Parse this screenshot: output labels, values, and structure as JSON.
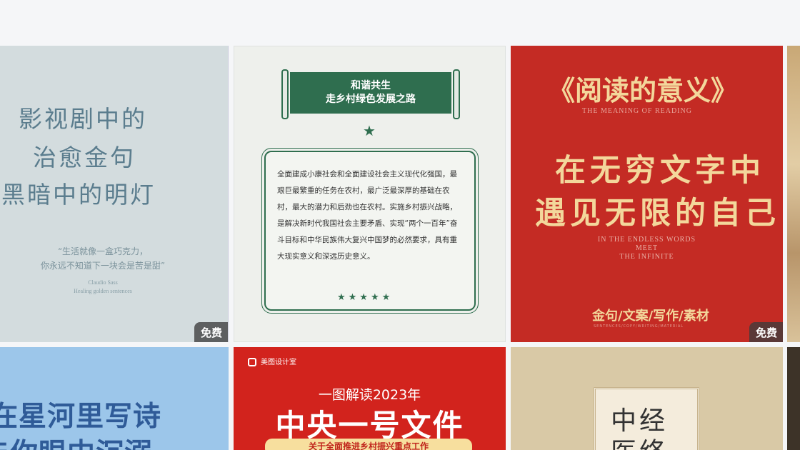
{
  "cards": [
    {
      "title_lines": [
        "影视剧中的",
        "治愈金句",
        "黑暗中的明灯"
      ],
      "quote_lines": [
        "“生活就像一盒巧克力，",
        "你永远不知道下一块会是苦是甜”"
      ],
      "sub_lines": [
        "Claudio Sass",
        "Healing golden sentences"
      ],
      "badge": "免费"
    },
    {
      "banner_lines": [
        "和谐共生",
        "走乡村绿色发展之路"
      ],
      "paragraph": "全面建成小康社会和全面建设社会主义现代化强国，最艰巨最繁重的任务在农村，最广泛最深厚的基础在农村，最大的潜力和后劲也在农村。实施乡村振兴战略，是解决新时代我国社会主要矛盾、实现“两个一百年”奋斗目标和中华民族伟大复兴中国梦的必然要求，具有重大现实意义和深远历史意义。",
      "star_single": "★",
      "stars_row": "★★★★★"
    },
    {
      "title": "《阅读的意义》",
      "subtitle": "THE MEANING OF READING",
      "lines": [
        "在无穷文字中",
        "遇见无限的自己"
      ],
      "en_lines": [
        "IN THE ENDLESS WORDS",
        "MEET",
        "THE INFINITE"
      ],
      "tags": "金句/文案/写作/素材",
      "tags_en": "SENTENCES/COPY/WRITING/MATERIAL",
      "badge": "免费"
    },
    {
      "text_lines": [
        "在星河里写诗",
        "与你眼中沉溺"
      ]
    },
    {
      "logo": "美图设计室",
      "line1": "一图解读2023年",
      "line2": "中央一号文件",
      "line3": "关于全面推进乡村振兴重点工作"
    },
    {
      "text_lines": [
        "中经",
        "医络"
      ]
    }
  ]
}
